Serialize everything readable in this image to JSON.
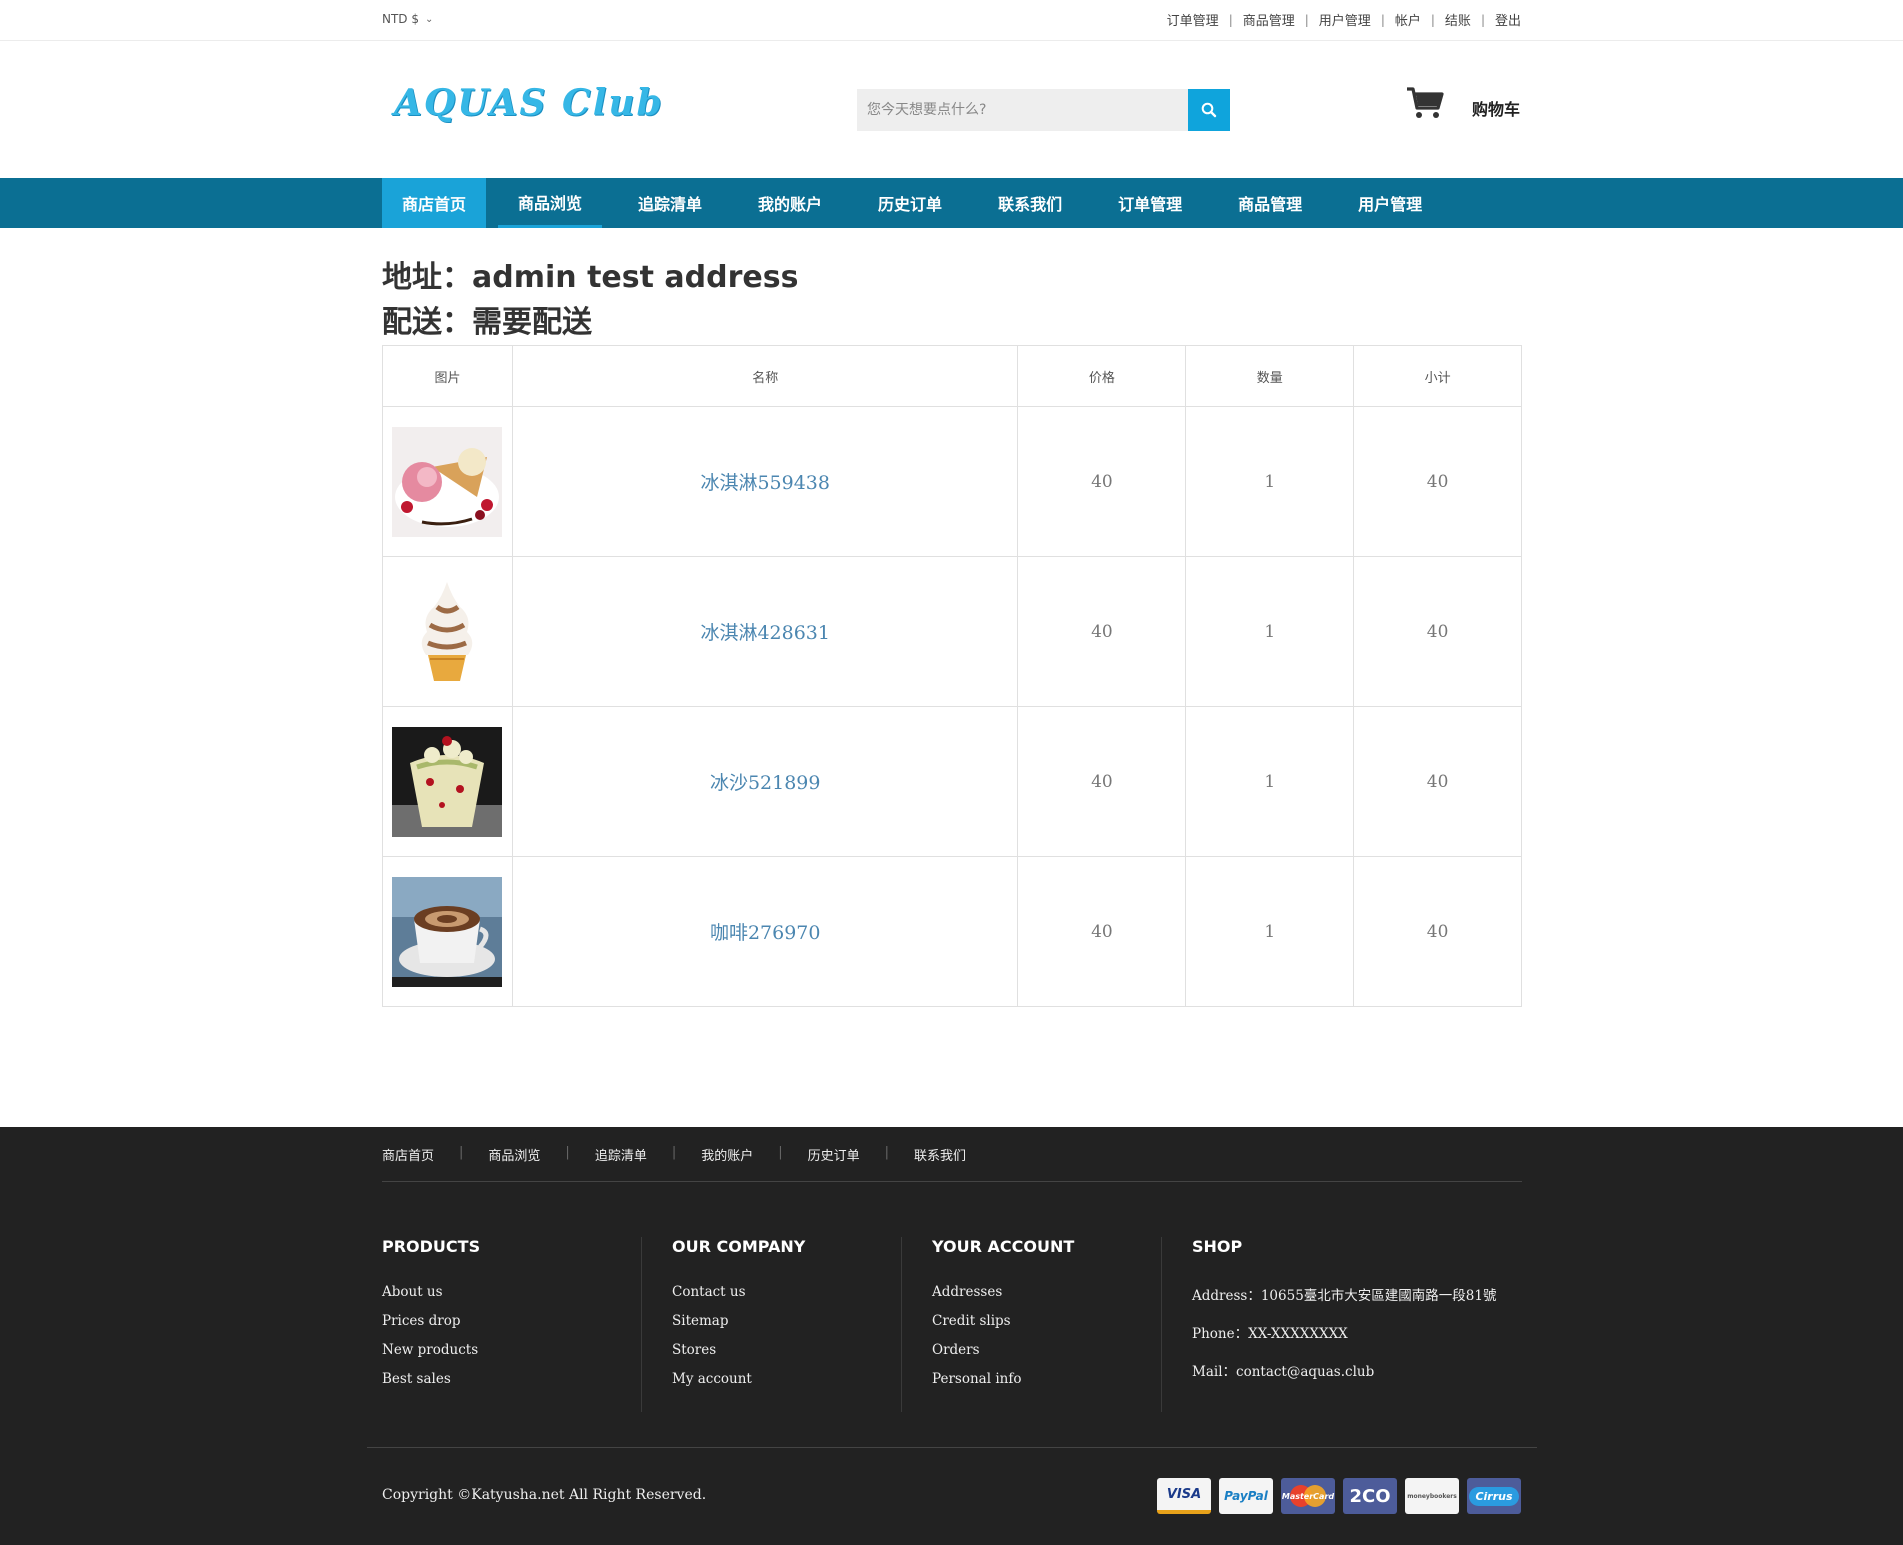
{
  "topbar": {
    "currency": "NTD $",
    "links": [
      "订单管理",
      "商品管理",
      "用户管理",
      "帐户",
      "结账",
      "登出"
    ]
  },
  "header": {
    "logo": "AQUAS Club",
    "search_placeholder": "您今天想要点什么?",
    "cart_label": "购物车"
  },
  "nav": {
    "items": [
      "商店首页",
      "商品浏览",
      "追踪清单",
      "我的账户",
      "历史订单",
      "联系我们",
      "订单管理",
      "商品管理",
      "用户管理"
    ]
  },
  "order": {
    "address": "地址：admin test address",
    "delivery": "配送：需要配送"
  },
  "table": {
    "headers": [
      "图片",
      "名称",
      "价格",
      "数量",
      "小计"
    ],
    "rows": [
      {
        "name": "冰淇淋559438",
        "price": "40",
        "qty": "1",
        "subtotal": "40",
        "image": "ice-cream-cones-image"
      },
      {
        "name": "冰淇淋428631",
        "price": "40",
        "qty": "1",
        "subtotal": "40",
        "image": "soft-serve-cone-image"
      },
      {
        "name": "冰沙521899",
        "price": "40",
        "qty": "1",
        "subtotal": "40",
        "image": "smoothie-cup-image"
      },
      {
        "name": "咖啡276970",
        "price": "40",
        "qty": "1",
        "subtotal": "40",
        "image": "coffee-cup-image"
      }
    ]
  },
  "footer": {
    "nav": [
      "商店首页",
      "商品浏览",
      "追踪清单",
      "我的账户",
      "历史订单",
      "联系我们"
    ],
    "columns": [
      {
        "title": "PRODUCTS",
        "items": [
          "About us",
          "Prices drop",
          "New products",
          "Best sales"
        ]
      },
      {
        "title": "OUR COMPANY",
        "items": [
          "Contact us",
          "Sitemap",
          "Stores",
          "My account"
        ]
      },
      {
        "title": "YOUR ACCOUNT",
        "items": [
          "Addresses",
          "Credit slips",
          "Orders",
          "Personal info"
        ]
      }
    ],
    "shop": {
      "title": "SHOP",
      "address": "Address：10655臺北市大安區建國南路一段81號",
      "phone": "Phone：XX-XXXXXXXX",
      "mail": "Mail：contact@aquas.club"
    },
    "copyright": "Copyright ©Katyusha.net All Right Reserved.",
    "payments": [
      "VISA",
      "PayPal",
      "MasterCard",
      "2CO",
      "moneybookers",
      "Cirrus"
    ]
  },
  "colors": {
    "nav_bg": "#0b6f93",
    "accent": "#1aa3d8",
    "footer_bg": "#222222",
    "logo": "#36b7e6"
  }
}
